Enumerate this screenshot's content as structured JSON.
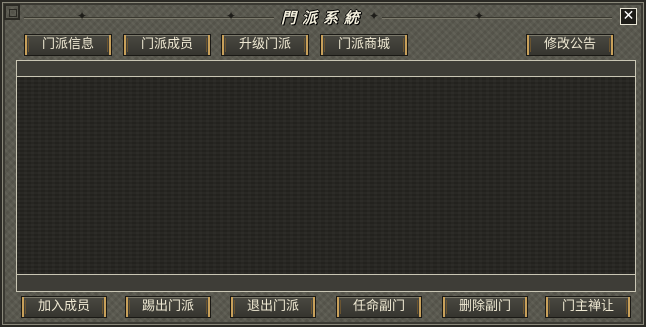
{
  "window": {
    "title": "門派系統",
    "close_icon": "close-icon"
  },
  "top_tabs": [
    {
      "label": "门派信息"
    },
    {
      "label": "门派成员"
    },
    {
      "label": "升级门派"
    },
    {
      "label": "门派商城"
    },
    {
      "label": "修改公告"
    }
  ],
  "bottom_actions": [
    {
      "label": "加入成员"
    },
    {
      "label": "踢出门派"
    },
    {
      "label": "退出门派"
    },
    {
      "label": "任命副门"
    },
    {
      "label": "删除副门"
    },
    {
      "label": "门主禅让"
    }
  ],
  "colors": {
    "frame": "#5b5a50",
    "panel": "#262521",
    "button_accent": "#c8a05a",
    "text": "#efe9d3"
  }
}
